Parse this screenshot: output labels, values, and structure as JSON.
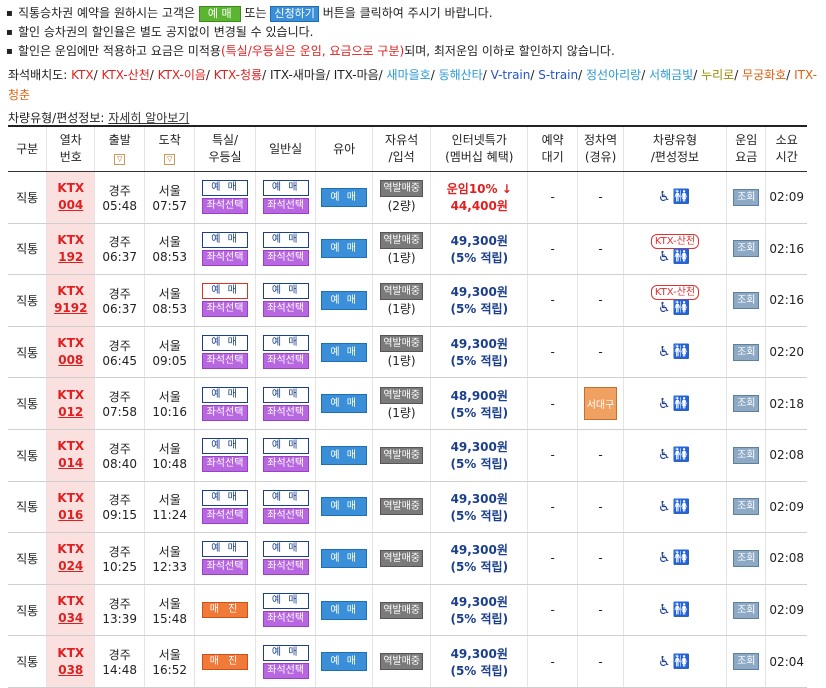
{
  "notices": [
    {
      "before": "직통승차권 예약을 원하시는 고객은",
      "btn1": "예 매",
      "mid": "또는",
      "btn2": "신청하기",
      "after": "버튼을 클릭하여 주시기 바랍니다."
    },
    {
      "text": "할인 승차권의 할인율은 별도 공지없이 변경될 수 있습니다."
    },
    {
      "before": "할인은 운임에만 적용하고 요금은 미적용",
      "red": "(특실/우등실은 운임, 요금으로 구분)",
      "after": "되며, 최저운임 이하로 할인하지 않습니다."
    }
  ],
  "legend": {
    "label": "좌석배치도:",
    "items": [
      {
        "text": "KTX",
        "color": "#e02020"
      },
      {
        "text": "KTX-산천",
        "color": "#e02020"
      },
      {
        "text": "KTX-이음",
        "color": "#e02020"
      },
      {
        "text": "KTX-청룡",
        "color": "#e02020"
      },
      {
        "text": "ITX-새마을",
        "color": "#222222"
      },
      {
        "text": "ITX-마음",
        "color": "#222222"
      },
      {
        "text": "새마을호",
        "color": "#2a9ad6"
      },
      {
        "text": "동해산타",
        "color": "#2a9ad6"
      },
      {
        "text": "V-train",
        "color": "#2255cc"
      },
      {
        "text": "S-train",
        "color": "#2255cc"
      },
      {
        "text": "정선아리랑",
        "color": "#2a9ad6"
      },
      {
        "text": "서해금빛",
        "color": "#2a9ad6"
      },
      {
        "text": "누리로",
        "color": "#9a8a00"
      },
      {
        "text": "무궁화호",
        "color": "#e06010"
      },
      {
        "text": "ITX-청춘",
        "color": "#e06010"
      }
    ]
  },
  "subinfo": {
    "label": "차량유형/편성정보:",
    "link": "자세히 알아보기"
  },
  "headers": [
    "구분",
    "열차\n번호",
    "출발",
    "도착",
    "특실/\n우등실",
    "일반실",
    "유아",
    "자유석\n/입석",
    "인터넷특가\n(멤버십 혜택)",
    "예약\n대기",
    "정차역\n(경유)",
    "차량유형\n/편성정보",
    "운임\n요금",
    "소요\n시간"
  ],
  "sort_glyph": "▽",
  "labels": {
    "sale": "예 매",
    "seat": "좌석선택",
    "closed": "매 진",
    "reverse": "역발매중",
    "query": "조회",
    "dash": "-"
  },
  "rows": [
    {
      "type": "직통",
      "train": "KTX",
      "no": "004",
      "from": "경주",
      "dep": "05:48",
      "to": "서울",
      "arr": "07:57",
      "special": "sale_seat",
      "general": "sale_seat",
      "standing": "(2량)",
      "fare_top": "운임10% ↓",
      "fare_top_red": true,
      "fare": "44,400원",
      "fare_red": true,
      "stop": "",
      "pill": "",
      "dur": "02:09"
    },
    {
      "type": "직통",
      "train": "KTX",
      "no": "192",
      "from": "경주",
      "dep": "06:37",
      "to": "서울",
      "arr": "08:53",
      "special": "sale_seat",
      "general": "sale_seat",
      "standing": "(1량)",
      "fare_top": "",
      "fare": "49,300원",
      "sub": "(5% 적립)",
      "stop": "",
      "pill": "KTX-산천",
      "dur": "02:16"
    },
    {
      "type": "직통",
      "train": "KTX",
      "no": "9192",
      "from": "경주",
      "dep": "06:37",
      "to": "서울",
      "arr": "08:53",
      "special": "sale_seat_red",
      "general": "sale_seat",
      "standing": "(1량)",
      "fare_top": "",
      "fare": "49,300원",
      "sub": "(5% 적립)",
      "stop": "",
      "pill": "KTX-산천",
      "dur": "02:16"
    },
    {
      "type": "직통",
      "train": "KTX",
      "no": "008",
      "from": "경주",
      "dep": "06:45",
      "to": "서울",
      "arr": "09:05",
      "special": "sale_seat",
      "general": "sale_seat",
      "standing": "(1량)",
      "fare_top": "",
      "fare": "49,300원",
      "sub": "(5% 적립)",
      "stop": "",
      "pill": "",
      "dur": "02:20"
    },
    {
      "type": "직통",
      "train": "KTX",
      "no": "012",
      "from": "경주",
      "dep": "07:58",
      "to": "서울",
      "arr": "10:16",
      "special": "sale_seat",
      "general": "sale_seat",
      "standing": "(1량)",
      "fare_top": "",
      "fare": "48,900원",
      "sub": "(5% 적립)",
      "stop": "서대구",
      "pill": "",
      "dur": "02:18"
    },
    {
      "type": "직통",
      "train": "KTX",
      "no": "014",
      "from": "경주",
      "dep": "08:40",
      "to": "서울",
      "arr": "10:48",
      "special": "sale_seat",
      "general": "sale_seat",
      "standing": "",
      "fare_top": "",
      "fare": "49,300원",
      "sub": "(5% 적립)",
      "stop": "",
      "pill": "",
      "dur": "02:08"
    },
    {
      "type": "직통",
      "train": "KTX",
      "no": "016",
      "from": "경주",
      "dep": "09:15",
      "to": "서울",
      "arr": "11:24",
      "special": "sale_seat",
      "general": "sale_seat",
      "standing": "",
      "fare_top": "",
      "fare": "49,300원",
      "sub": "(5% 적립)",
      "stop": "",
      "pill": "",
      "dur": "02:09"
    },
    {
      "type": "직통",
      "train": "KTX",
      "no": "024",
      "from": "경주",
      "dep": "10:25",
      "to": "서울",
      "arr": "12:33",
      "special": "sale_seat",
      "general": "sale_seat",
      "standing": "",
      "fare_top": "",
      "fare": "49,300원",
      "sub": "(5% 적립)",
      "stop": "",
      "pill": "",
      "dur": "02:08"
    },
    {
      "type": "직통",
      "train": "KTX",
      "no": "034",
      "from": "경주",
      "dep": "13:39",
      "to": "서울",
      "arr": "15:48",
      "special": "closed",
      "general": "sale_seat",
      "standing": "",
      "fare_top": "",
      "fare": "49,300원",
      "sub": "(5% 적립)",
      "stop": "",
      "pill": "",
      "dur": "02:09"
    },
    {
      "type": "직통",
      "train": "KTX",
      "no": "038",
      "from": "경주",
      "dep": "14:48",
      "to": "서울",
      "arr": "16:52",
      "special": "closed",
      "general": "sale_seat",
      "standing": "",
      "fare_top": "",
      "fare": "49,300원",
      "sub": "(5% 적립)",
      "stop": "",
      "pill": "",
      "dur": "02:04"
    }
  ]
}
